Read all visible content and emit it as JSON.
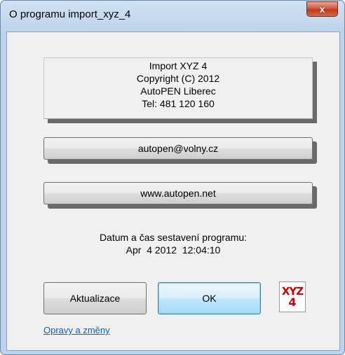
{
  "window": {
    "title": "O programu import_xyz_4",
    "close_label": "x"
  },
  "info": {
    "lines": [
      "Import XYZ 4",
      "Copyright (C) 2012",
      "AutoPEN Liberec",
      "Tel: 481 120 160"
    ]
  },
  "buttons": {
    "email": "autopen@volny.cz",
    "web": "www.autopen.net",
    "update": "Aktualizace",
    "ok": "OK"
  },
  "build": {
    "label": "Datum a čas sestavení programu:",
    "datetime": "Apr  4 2012  12:04:10"
  },
  "logo": {
    "line1": "XYZ",
    "line2": "4"
  },
  "link": {
    "changes": "Opravy a změny"
  },
  "colors": {
    "title_bar": "#bcd3eb",
    "close_button": "#c7432a",
    "ok_accent": "#3c7fb1",
    "logo_text": "#d00000",
    "link": "#0066cc"
  }
}
